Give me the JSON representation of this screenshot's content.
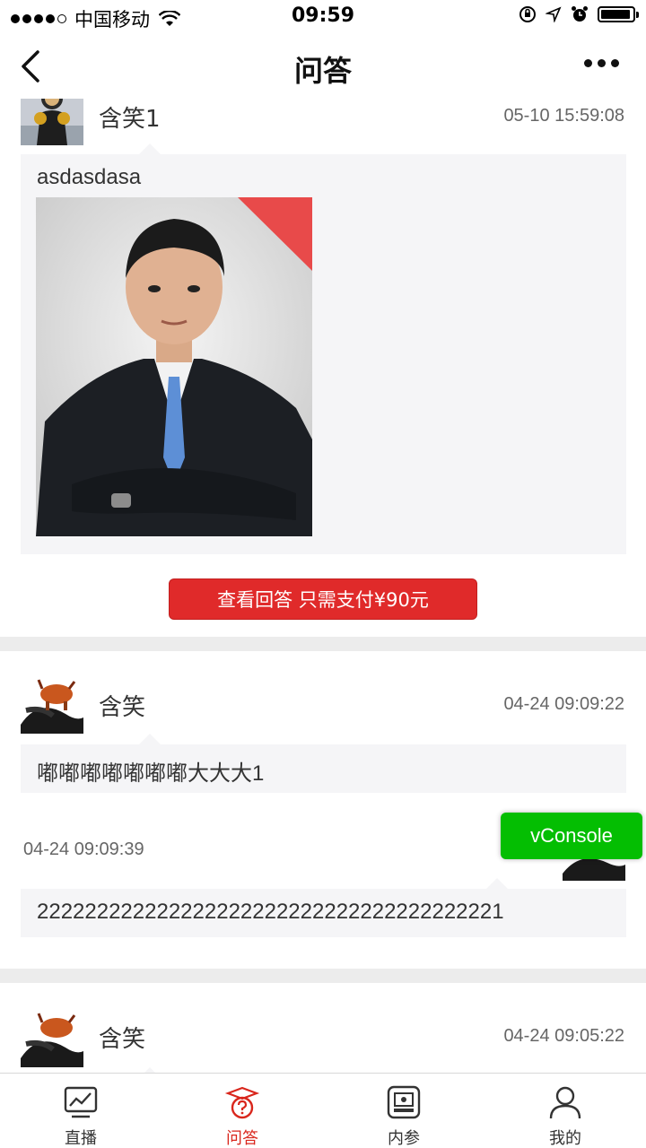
{
  "status_bar": {
    "carrier": "中国移动",
    "time": "09:59",
    "battery_level": 0.95
  },
  "nav": {
    "title": "问答",
    "back_icon": "chevron-left-icon",
    "more_icon": "more-dots-icon"
  },
  "questions": [
    {
      "user_name": "含笑1",
      "time": "05-10 15:59:08",
      "text": "asdasdasa",
      "pay_button_label": "查看回答 只需支付¥90元"
    },
    {
      "user_name": "含笑",
      "time": "04-24 09:09:22",
      "text": "嘟嘟嘟嘟嘟嘟嘟大大大1",
      "answer": {
        "time": "04-24 09:09:39",
        "text": "222222222222222222222222222222222222221"
      }
    },
    {
      "user_name": "含笑",
      "time": "04-24 09:05:22"
    }
  ],
  "vconsole_label": "vConsole",
  "tabs": [
    {
      "label": "直播",
      "icon": "chart-board-icon",
      "active": false
    },
    {
      "label": "问答",
      "icon": "question-cap-icon",
      "active": true
    },
    {
      "label": "内参",
      "icon": "presentation-icon",
      "active": false
    },
    {
      "label": "我的",
      "icon": "user-icon",
      "active": false
    }
  ],
  "colors": {
    "accent": "#e02a2a",
    "active_tab": "#d9261c",
    "vconsole": "#04be02",
    "bubble_bg": "#f5f5f7"
  }
}
